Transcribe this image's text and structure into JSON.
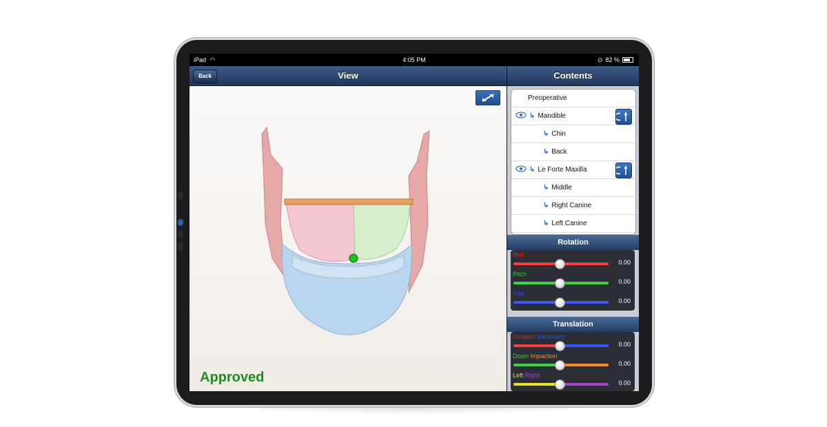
{
  "status_bar": {
    "device": "iPad",
    "time": "4:05 PM",
    "battery": "82 %"
  },
  "left_nav": {
    "back_label": "Back",
    "title": "View"
  },
  "right_nav": {
    "title": "Contents"
  },
  "view": {
    "status_label": "Approved",
    "status_color": "#1e8f1e"
  },
  "contents": {
    "items": [
      {
        "label": "Preoperative",
        "level": 0,
        "eye": false,
        "tool": false
      },
      {
        "label": "Mandible",
        "level": 1,
        "eye": true,
        "tool": true
      },
      {
        "label": "Chin",
        "level": 2,
        "eye": false,
        "tool": false
      },
      {
        "label": "Back",
        "level": 2,
        "eye": false,
        "tool": false
      },
      {
        "label": "Le Forte Maxilla",
        "level": 1,
        "eye": true,
        "tool": true
      },
      {
        "label": "Middle",
        "level": 2,
        "eye": false,
        "tool": false
      },
      {
        "label": "Right Canine",
        "level": 2,
        "eye": false,
        "tool": false
      },
      {
        "label": "Left Canine",
        "level": 2,
        "eye": false,
        "tool": false
      }
    ]
  },
  "rotation": {
    "header": "Rotation",
    "sliders": [
      {
        "label_a": "Roll",
        "color_a": "#e02020",
        "label_b": "",
        "color_b": "",
        "value": "0.00",
        "track": "#ff3b3b"
      },
      {
        "label_a": "Pitch",
        "color_a": "#30d030",
        "label_b": "",
        "color_b": "",
        "value": "0.00",
        "track": "#3ad83a"
      },
      {
        "label_a": "Yaw",
        "color_a": "#2a4cff",
        "label_b": "",
        "color_b": "",
        "value": "0.00",
        "track": "#3b56ff"
      }
    ]
  },
  "translation": {
    "header": "Translation",
    "sliders": [
      {
        "label_a": "Forward",
        "color_a": "#e02020",
        "label_b": "Backward",
        "color_b": "#2a4cff",
        "value": "0.00",
        "track_a": "#ff3b3b",
        "track_b": "#3b56ff"
      },
      {
        "label_a": "Down",
        "color_a": "#30d030",
        "label_b": "Impaction",
        "color_b": "#ff8a1c",
        "value": "0.00",
        "track_a": "#3ad83a",
        "track_b": "#ff8a1c"
      },
      {
        "label_a": "Left",
        "color_a": "#f2e01a",
        "label_b": "Right",
        "color_b": "#b040d0",
        "value": "0.00",
        "track_a": "#f2e01a",
        "track_b": "#b040d0"
      }
    ]
  }
}
